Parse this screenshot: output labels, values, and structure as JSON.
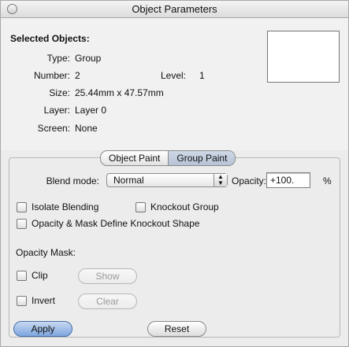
{
  "window": {
    "title": "Object Parameters"
  },
  "selection": {
    "heading": "Selected Objects:",
    "type_label": "Type:",
    "type_value": "Group",
    "number_label": "Number:",
    "number_value": "2",
    "level_label": "Level:",
    "level_value": "1",
    "size_label": "Size:",
    "size_value": "25.44mm x 47.57mm",
    "layer_label": "Layer:",
    "layer_value": "Layer 0",
    "screen_label": "Screen:",
    "screen_value": "None"
  },
  "tabs": [
    {
      "label": "Object Paint",
      "active": false
    },
    {
      "label": "Group Paint",
      "active": true
    }
  ],
  "blend": {
    "label": "Blend mode:",
    "value": "Normal",
    "opacity_label": "Opacity:",
    "opacity_value": "+100.",
    "opacity_unit": "%"
  },
  "options": {
    "isolate": "Isolate Blending",
    "knockout": "Knockout Group",
    "opacity_mask_shape": "Opacity & Mask Define Knockout Shape"
  },
  "mask": {
    "heading": "Opacity Mask:",
    "clip": "Clip",
    "show": "Show",
    "invert": "Invert",
    "clear": "Clear"
  },
  "footer": {
    "apply": "Apply",
    "reset": "Reset"
  }
}
